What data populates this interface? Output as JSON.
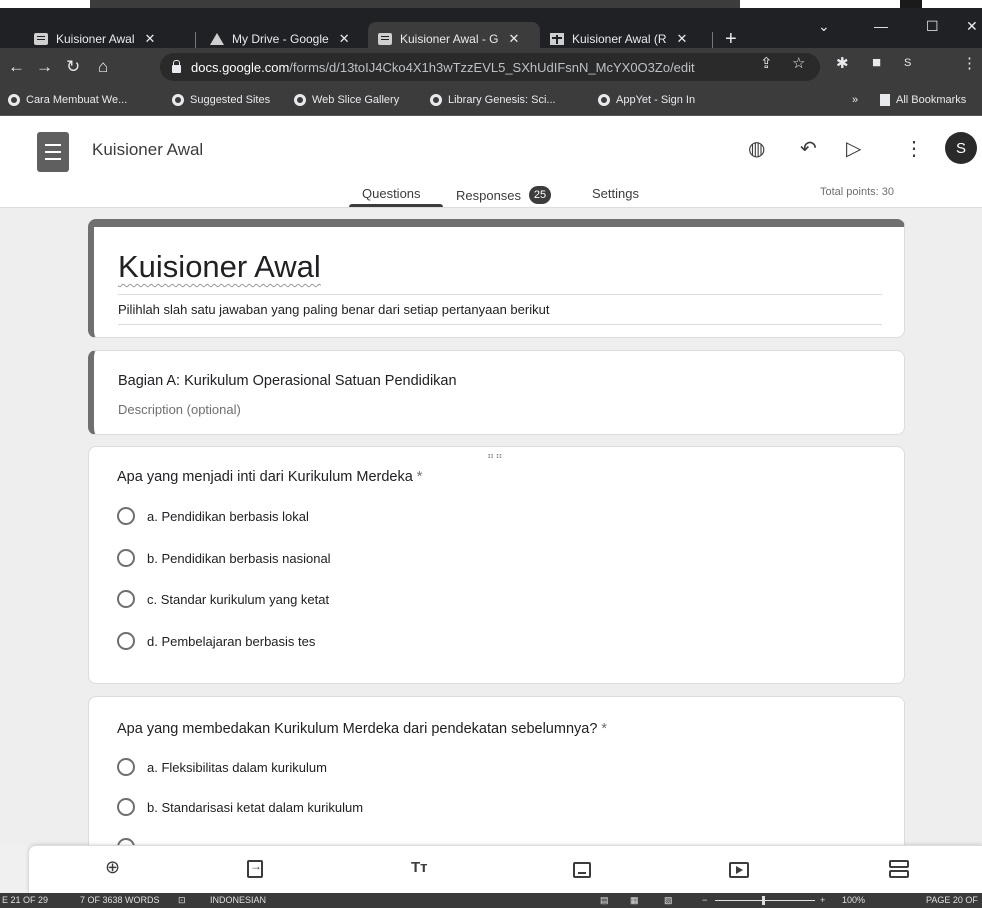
{
  "browser": {
    "tabs": [
      {
        "title": "Kuisioner Awal",
        "close": "✕"
      },
      {
        "title": "My Drive - Google",
        "close": "✕"
      },
      {
        "title": "Kuisioner Awal - G",
        "close": "✕"
      },
      {
        "title": "Kuisioner Awal (R",
        "close": "✕"
      }
    ],
    "new_tab": "+",
    "url_host": "docs.google.com",
    "url_path": "/forms/d/13toIJ4Cko4X1h3wTzzEVL5_SXhUdIFsnN_McYX0O3Zo/edit",
    "profile_initial": "S",
    "bookmarks": [
      "Cara Membuat We...",
      "Suggested Sites",
      "Web Slice Gallery",
      "Library Genesis: Sci...",
      "AppYet - Sign In"
    ],
    "bookmarks_overflow": "»",
    "all_bookmarks": "All Bookmarks"
  },
  "forms_header": {
    "doc_title": "Kuisioner Awal",
    "avatar_initial": "S",
    "tabs": {
      "questions": "Questions",
      "responses": "Responses",
      "settings": "Settings"
    },
    "responses_count": "25",
    "total_points": "Total points: 30"
  },
  "form": {
    "title": "Kuisioner Awal",
    "description": "Pilihlah slah satu jawaban yang paling benar dari setiap pertanyaan berikut",
    "section": {
      "title": "Bagian A: Kurikulum Operasional Satuan Pendidikan",
      "description_placeholder": "Description (optional)"
    },
    "questions": [
      {
        "text": "Apa yang menjadi inti dari Kurikulum Merdeka",
        "required_mark": "*",
        "options": [
          "a. Pendidikan berbasis lokal",
          "b. Pendidikan berbasis nasional",
          "c. Standar kurikulum yang ketat",
          "d. Pembelajaran berbasis tes"
        ]
      },
      {
        "text": "Apa yang membedakan Kurikulum Merdeka dari pendekatan sebelumnya?",
        "required_mark": "*",
        "options": [
          "a. Fleksibilitas dalam kurikulum",
          "b. Standarisasi ketat dalam kurikulum"
        ]
      }
    ]
  },
  "toolbar": {
    "text_tool_glyph": "Tт",
    "add_glyph": "⊕"
  },
  "word_status": {
    "page": "E 21 OF 29",
    "words": "7 OF 3638 WORDS",
    "language": "INDONESIAN",
    "zoom": "100%",
    "page_right": "PAGE 20 OF"
  }
}
